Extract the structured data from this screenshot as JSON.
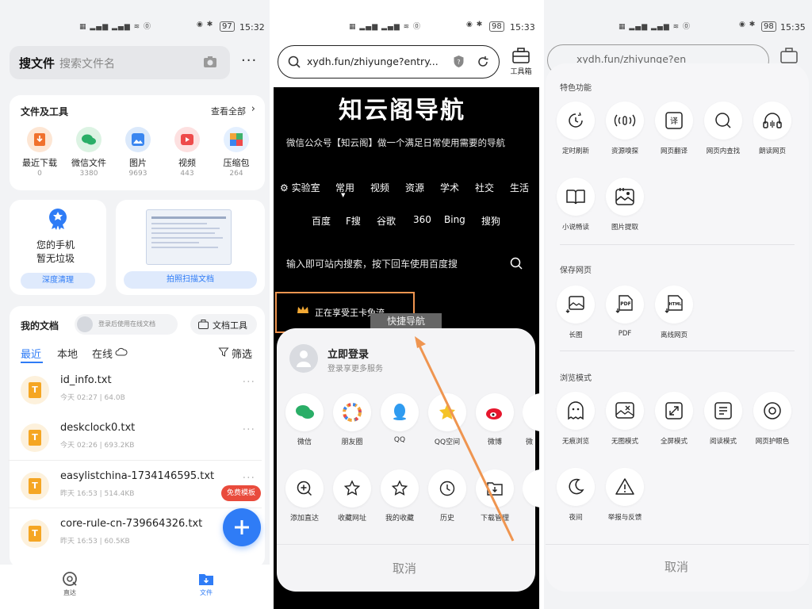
{
  "status": {
    "p1_battery": "97",
    "p1_time": "15:32",
    "p2_battery": "98",
    "p2_time": "15:33",
    "p3_battery": "98",
    "p3_time": "15:35"
  },
  "file_app": {
    "search": {
      "title": "搜文件",
      "placeholder": "搜索文件名"
    },
    "tools_card": {
      "title": "文件及工具",
      "view_all": "查看全部",
      "tools": [
        {
          "label": "最近下载",
          "count": "0"
        },
        {
          "label": "微信文件",
          "count": "3380"
        },
        {
          "label": "图片",
          "count": "9693"
        },
        {
          "label": "视频",
          "count": "443"
        },
        {
          "label": "压缩包",
          "count": "264"
        }
      ]
    },
    "clean_card": {
      "line1": "您的手机",
      "line2": "暂无垃圾",
      "button": "深度清理"
    },
    "scan_card": {
      "button": "拍照扫描文档"
    },
    "docs": {
      "title": "我的文档",
      "login_hint": "登录后使用在线文档",
      "tools_button": "文档工具",
      "tabs": [
        "最近",
        "本地",
        "在线"
      ],
      "filter": "筛选",
      "files": [
        {
          "name": "id_info.txt",
          "meta": "今天 02:27 | 64.0B"
        },
        {
          "name": "deskclock0.txt",
          "meta": "今天 02:26 | 693.2KB"
        },
        {
          "name": "easylistchina-1734146595.txt",
          "meta": "昨天 16:53 | 514.4KB"
        },
        {
          "name": "core-rule-cn-739664326.txt",
          "meta": "昨天 16:53 | 60.5KB"
        }
      ]
    },
    "free_badge": "免费模板",
    "bottom_nav": [
      {
        "label": "直达"
      },
      {
        "label": "文件"
      }
    ]
  },
  "browser": {
    "url": "xydh.fun/zhiyunge?entry...",
    "toolbox_label": "工具箱",
    "site_title": "知云阁导航",
    "site_subtitle": "微信公众号【知云阁】做一个满足日常使用需要的导航",
    "nav_tabs": [
      "实验室",
      "常用",
      "视频",
      "资源",
      "学术",
      "社交",
      "生活"
    ],
    "engines": [
      "百度",
      "F搜",
      "谷歌",
      "360",
      "Bing",
      "搜狗"
    ],
    "search_placeholder": "输入即可站内搜索，按下回车使用百度搜",
    "vip_text": "正在享受王卡免流",
    "quick_nav": "快捷导航",
    "sheet": {
      "login_title": "立即登录",
      "login_sub": "登录享更多服务",
      "share_row": [
        {
          "label": "微信"
        },
        {
          "label": "朋友圈"
        },
        {
          "label": "QQ"
        },
        {
          "label": "QQ空间"
        },
        {
          "label": "微博"
        },
        {
          "label": "微"
        }
      ],
      "action_row": [
        {
          "label": "添加直达"
        },
        {
          "label": "收藏网址"
        },
        {
          "label": "我的收藏"
        },
        {
          "label": "历史"
        },
        {
          "label": "下载管理"
        }
      ],
      "cancel": "取消"
    },
    "colors": {
      "arrow": "#ef9550",
      "highlight": "#ef9550"
    }
  },
  "menu": {
    "url": "xydh.fun/zhiyunge?en",
    "sections": [
      {
        "title": "特色功能",
        "items": [
          {
            "label": "定时刷新",
            "icon": "clock-icon"
          },
          {
            "label": "资源嗅探",
            "icon": "sniff-icon"
          },
          {
            "label": "网页翻译",
            "icon": "translate-icon"
          },
          {
            "label": "网页内查找",
            "icon": "find-icon"
          },
          {
            "label": "朗读网页",
            "icon": "headphones-icon"
          },
          {
            "label": "小说畅读",
            "icon": "book-icon"
          },
          {
            "label": "图片提取",
            "icon": "image-extract-icon"
          }
        ]
      },
      {
        "title": "保存网页",
        "items": [
          {
            "label": "长图",
            "icon": "long-image-icon"
          },
          {
            "label": "PDF",
            "icon": "pdf-icon"
          },
          {
            "label": "离线网页",
            "icon": "html-icon"
          }
        ]
      },
      {
        "title": "浏览模式",
        "items": [
          {
            "label": "无痕浏览",
            "icon": "ghost-icon"
          },
          {
            "label": "无图模式",
            "icon": "no-image-icon"
          },
          {
            "label": "全屏模式",
            "icon": "fullscreen-icon"
          },
          {
            "label": "阅读模式",
            "icon": "reader-icon"
          },
          {
            "label": "网页护眼色",
            "icon": "eye-icon"
          },
          {
            "label": "夜间",
            "icon": "moon-icon"
          },
          {
            "label": "举报与反馈",
            "icon": "warning-icon"
          }
        ]
      }
    ],
    "cancel": "取消"
  }
}
